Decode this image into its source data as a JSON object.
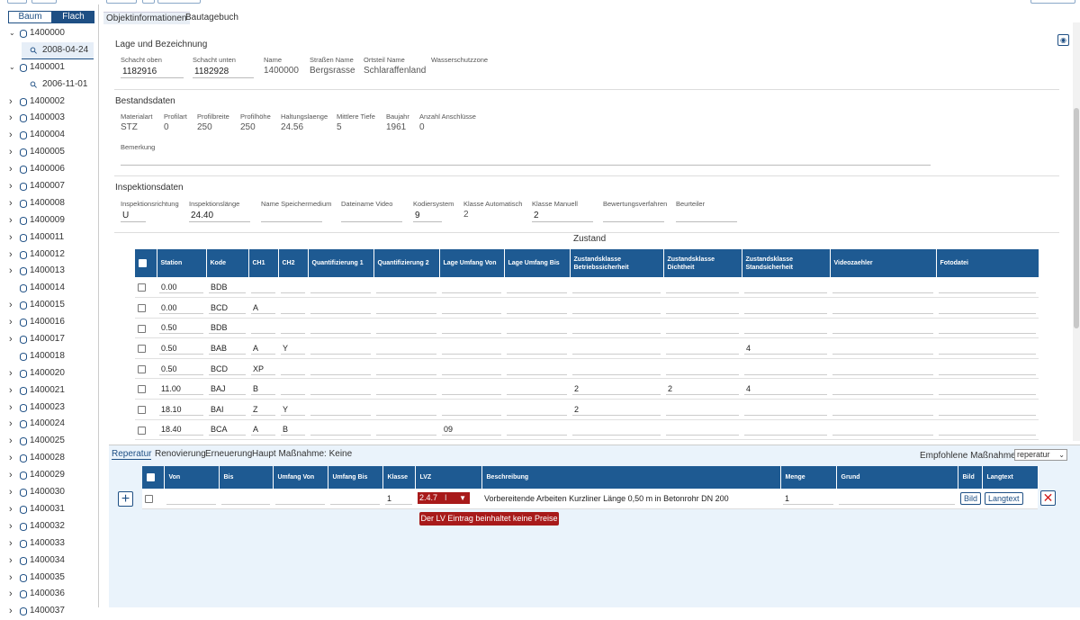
{
  "sidebar": {
    "toggle_baum": "Baum",
    "toggle_flach": "Flach",
    "tree": [
      {
        "label": "1400000",
        "expanded": true,
        "children": [
          {
            "label": "2008-04-24",
            "selected": true
          }
        ]
      },
      {
        "label": "1400001",
        "expanded": true,
        "children": [
          {
            "label": "2006-11-01"
          }
        ]
      },
      {
        "label": "1400002"
      },
      {
        "label": "1400003"
      },
      {
        "label": "1400004"
      },
      {
        "label": "1400005"
      },
      {
        "label": "1400006"
      },
      {
        "label": "1400007"
      },
      {
        "label": "1400008"
      },
      {
        "label": "1400009"
      },
      {
        "label": "1400011"
      },
      {
        "label": "1400012"
      },
      {
        "label": "1400013"
      },
      {
        "label": "1400014",
        "leaf": true
      },
      {
        "label": "1400015"
      },
      {
        "label": "1400016"
      },
      {
        "label": "1400017"
      },
      {
        "label": "1400018",
        "leaf": true
      },
      {
        "label": "1400020"
      },
      {
        "label": "1400021"
      },
      {
        "label": "1400023"
      },
      {
        "label": "1400024"
      },
      {
        "label": "1400025"
      },
      {
        "label": "1400028"
      },
      {
        "label": "1400029"
      },
      {
        "label": "1400030"
      },
      {
        "label": "1400031"
      },
      {
        "label": "1400032"
      },
      {
        "label": "1400033"
      },
      {
        "label": "1400034"
      },
      {
        "label": "1400035"
      },
      {
        "label": "1400036"
      },
      {
        "label": "1400037"
      }
    ]
  },
  "tabs": {
    "objekt": "Objektinformationen",
    "bautagebuch": "Bautagebuch"
  },
  "lage": {
    "title": "Lage und Bezeichnung",
    "fields": [
      {
        "label": "Schacht oben",
        "value": "1182916",
        "input": true
      },
      {
        "label": "Schacht unten",
        "value": "1182928",
        "input": true
      },
      {
        "label": "Name",
        "value": "1400000"
      },
      {
        "label": "Straßen Name",
        "value": "Bergsrasse"
      },
      {
        "label": "Ortsteil Name",
        "value": "Schlaraffenland"
      },
      {
        "label": "Wasserschutzzone",
        "value": ""
      }
    ]
  },
  "bestand": {
    "title": "Bestandsdaten",
    "fields": [
      {
        "label": "Materialart",
        "value": "STZ"
      },
      {
        "label": "Profilart",
        "value": "0"
      },
      {
        "label": "Profilbreite",
        "value": "250"
      },
      {
        "label": "Profilhöhe",
        "value": "250"
      },
      {
        "label": "Haltungslaenge",
        "value": "24.56"
      },
      {
        "label": "Mittlere Tiefe",
        "value": "5"
      },
      {
        "label": "Baujahr",
        "value": "1961"
      },
      {
        "label": "Anzahl Anschlüsse",
        "value": "0"
      }
    ],
    "bemerkung_label": "Bemerkung",
    "bemerkung_value": ""
  },
  "inspektion": {
    "title": "Inspektionsdaten",
    "fields": [
      {
        "label": "Inspektionsrichtung",
        "value": "U",
        "input": true
      },
      {
        "label": "Inspektionslänge",
        "value": "24.40",
        "input": true
      },
      {
        "label": "Name Speichermedium",
        "value": "",
        "input": true
      },
      {
        "label": "Dateiname Video",
        "value": "",
        "input": true
      },
      {
        "label": "Kodiersystem",
        "value": "9",
        "input": true
      },
      {
        "label": "Klasse Automatisch",
        "value": "2"
      },
      {
        "label": "Klasse Manuell",
        "value": "2",
        "input": true
      },
      {
        "label": "Bewertungsverfahren",
        "value": "",
        "input": true
      },
      {
        "label": "Beurteiler",
        "value": "",
        "input": true
      }
    ]
  },
  "zustand": {
    "title": "Zustand",
    "headers": [
      "Station",
      "Kode",
      "CH1",
      "CH2",
      "Quantifizierung 1",
      "Quantifizierung 2",
      "Lage Umfang Von",
      "Lage Umfang Bis",
      "Zustandsklasse Betriebssicherheit",
      "Zustandsklasse Dichtheit",
      "Zustandsklasse Standsicherheit",
      "Videozaehler",
      "Fotodatei"
    ],
    "rows": [
      [
        "0.00",
        "BDB",
        "",
        "",
        "",
        "",
        "",
        "",
        "",
        "",
        "",
        "",
        ""
      ],
      [
        "0.00",
        "BCD",
        "A",
        "",
        "",
        "",
        "",
        "",
        "",
        "",
        "",
        "",
        ""
      ],
      [
        "0.50",
        "BDB",
        "",
        "",
        "",
        "",
        "",
        "",
        "",
        "",
        "",
        "",
        ""
      ],
      [
        "0.50",
        "BAB",
        "A",
        "Y",
        "",
        "",
        "",
        "",
        "",
        "",
        "4",
        "",
        ""
      ],
      [
        "0.50",
        "BCD",
        "XP",
        "",
        "",
        "",
        "",
        "",
        "",
        "",
        "",
        "",
        ""
      ],
      [
        "11.00",
        "BAJ",
        "B",
        "",
        "",
        "",
        "",
        "",
        "2",
        "2",
        "4",
        "",
        ""
      ],
      [
        "18.10",
        "BAI",
        "Z",
        "Y",
        "",
        "",
        "",
        "",
        "2",
        "",
        "",
        "",
        ""
      ],
      [
        "18.40",
        "BCA",
        "A",
        "B",
        "",
        "",
        "09",
        "",
        "",
        "",
        "",
        "",
        ""
      ]
    ]
  },
  "massnahme": {
    "tabs": [
      "Reperatur",
      "Renovierung",
      "Erneuerung",
      "Haupt Maßnahme: Keine"
    ],
    "empfohlen_label": "Empfohlene Maßnahme:",
    "empfohlen_value": "reperatur",
    "headers": [
      "Von",
      "Bis",
      "Umfang Von",
      "Umfang Bis",
      "Klasse",
      "LVZ",
      "Beschreibung",
      "Menge",
      "Grund",
      "Bild",
      "Langtext"
    ],
    "row": {
      "von": "",
      "bis": "",
      "umfang_von": "",
      "umfang_bis": "",
      "klasse": "1",
      "lvz": "2.4.7",
      "beschreibung": "Vorbereitende Arbeiten Kurzliner Länge 0,50 m in Betonrohr DN 200",
      "menge": "1",
      "grund": "",
      "bild_btn": "Bild",
      "langtext_btn": "Langtext"
    },
    "tooltip": "Der LV Eintrag beinhaltet keine Preise"
  },
  "colors": {
    "primary": "#1e5a92",
    "error": "#a81a1a",
    "panel_bg": "#eaf3fb"
  }
}
